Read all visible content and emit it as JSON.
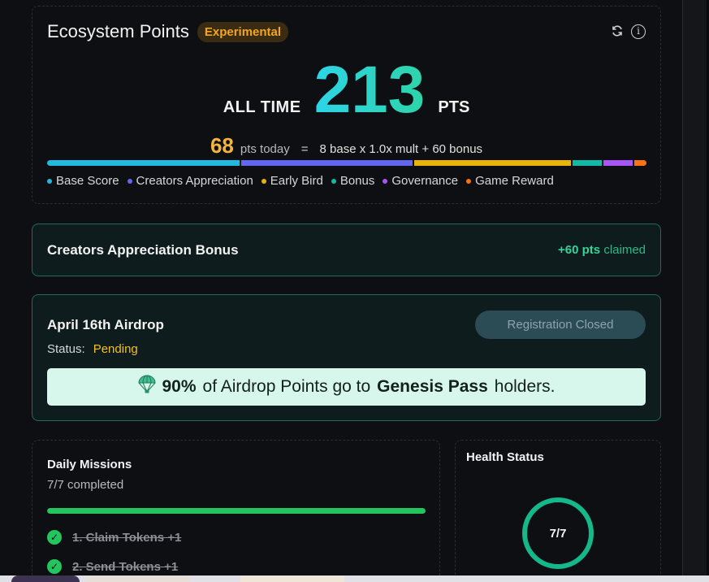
{
  "points": {
    "title": "Ecosystem Points",
    "badge": "Experimental",
    "refresh_icon": "refresh-icon",
    "info_icon": "info-icon",
    "all_time_label": "ALL TIME",
    "all_time_value": "213",
    "pts_label": "PTS",
    "today_value": "68",
    "today_text": "pts today",
    "equals": "=",
    "formula": "8 base x 1.0x mult + 60 bonus",
    "breakdown_fractions": [
      0.325,
      0.29,
      0.265,
      0.05,
      0.05,
      0.02
    ],
    "legend": [
      {
        "label": "Base Score",
        "color": "#22b8e0"
      },
      {
        "label": "Creators Appreciation",
        "color": "#6366f1"
      },
      {
        "label": "Early Bird",
        "color": "#eab308"
      },
      {
        "label": "Bonus",
        "color": "#14b8a6"
      },
      {
        "label": "Governance",
        "color": "#a855f7"
      },
      {
        "label": "Game Reward",
        "color": "#f97316"
      }
    ]
  },
  "creators_bonus": {
    "title": "Creators Appreciation Bonus",
    "amount": "+60 pts",
    "status": "claimed"
  },
  "airdrop": {
    "title": "April 16th Airdrop",
    "status_label": "Status:",
    "status_value": "Pending",
    "button_label": "Registration Closed",
    "icon": "parachute-icon",
    "percent": "90%",
    "text_mid": "of Airdrop Points go to",
    "pass_name": "Genesis Pass",
    "text_end": "holders."
  },
  "missions": {
    "title": "Daily Missions",
    "subtitle": "7/7 completed",
    "progress_fraction": 1.0,
    "items": [
      {
        "label": "1. Claim Tokens",
        "reward": "+1"
      },
      {
        "label": "2. Send Tokens",
        "reward": "+1"
      }
    ]
  },
  "health": {
    "title": "Health Status",
    "value": "7/7"
  }
}
